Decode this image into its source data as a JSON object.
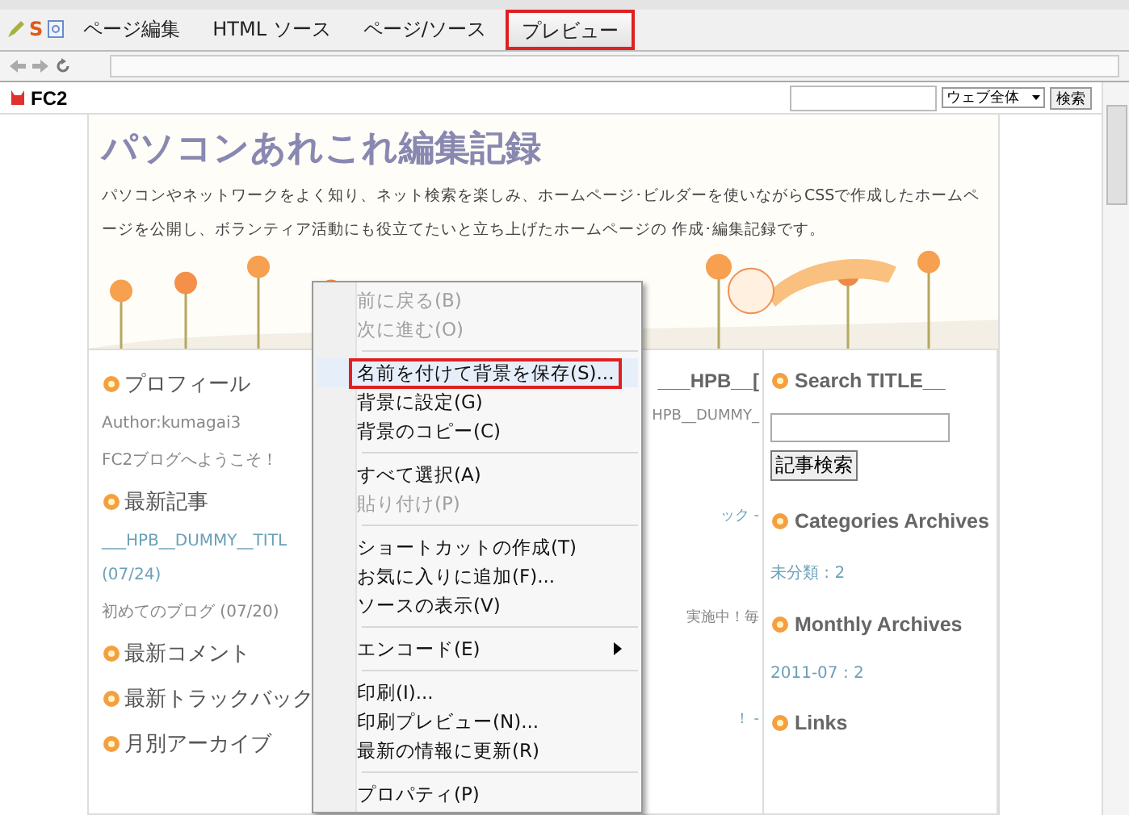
{
  "editor_tabs": [
    {
      "label": "ページ編集",
      "selected": false,
      "annotated": false
    },
    {
      "label": "HTML ソース",
      "selected": false,
      "annotated": false
    },
    {
      "label": "ページ/ソース",
      "selected": false,
      "annotated": false
    },
    {
      "label": "プレビュー",
      "selected": true,
      "annotated": true
    }
  ],
  "s_icon": "S",
  "fc2_bar": {
    "logo": "FC2",
    "scope": "ウェブ全体",
    "search_button": "検索"
  },
  "blog": {
    "title": "パソコンあれこれ編集記録",
    "description": "パソコンやネットワークをよく知り、ネット検索を楽しみ、ホームページ･ビルダーを使いながらCSSで作成したホームページを公開し、ボランティア活動にも役立てたいと立ち上げたホームページの 作成･編集記録です。",
    "left_column": [
      {
        "kind": "heading",
        "text": "プロフィール"
      },
      {
        "kind": "text",
        "text": "Author:kumagai3"
      },
      {
        "kind": "text",
        "text": "FC2ブログへようこそ！"
      },
      {
        "kind": "heading",
        "text": "最新記事"
      },
      {
        "kind": "link",
        "text": "___HPB__DUMMY__TITL"
      },
      {
        "kind": "link",
        "text": "(07/24)"
      },
      {
        "kind": "text",
        "text": "初めてのブログ (07/20)"
      },
      {
        "kind": "heading",
        "text": "最新コメント"
      },
      {
        "kind": "heading",
        "text": "最新トラックバック"
      },
      {
        "kind": "heading",
        "text": "月別アーカイブ"
      }
    ],
    "center_column": [
      {
        "kind": "heading",
        "text": "___HPB__["
      },
      {
        "kind": "text",
        "text": "HPB__DUMMY_"
      },
      {
        "kind": "link",
        "text": "ック -"
      },
      {
        "kind": "text",
        "text": "実施中！毎"
      },
      {
        "kind": "link",
        "text": "！ -"
      }
    ],
    "right_column": {
      "search_heading": "Search",
      "search_heading_overlap": "TITLE__",
      "search_button": "記事検索",
      "sections": [
        {
          "kind": "heading",
          "text": "Categories Archives"
        },
        {
          "kind": "link",
          "text": "未分類 : 2"
        },
        {
          "kind": "heading",
          "text": "Monthly Archives"
        },
        {
          "kind": "link",
          "text": "2011-07 : 2"
        },
        {
          "kind": "heading",
          "text": "Links"
        }
      ]
    }
  },
  "context_menu": {
    "groups": [
      {
        "items": [
          {
            "label": "前に戻る(B)",
            "disabled": true,
            "selected": false
          },
          {
            "label": "次に進む(O)",
            "disabled": true,
            "selected": false
          }
        ]
      },
      {
        "items": [
          {
            "label": "名前を付けて背景を保存(S)...",
            "disabled": false,
            "selected": true
          },
          {
            "label": "背景に設定(G)",
            "disabled": false,
            "selected": false
          },
          {
            "label": "背景のコピー(C)",
            "disabled": false,
            "selected": false
          }
        ]
      },
      {
        "items": [
          {
            "label": "すべて選択(A)",
            "disabled": false,
            "selected": false
          },
          {
            "label": "貼り付け(P)",
            "disabled": true,
            "selected": false
          }
        ]
      },
      {
        "items": [
          {
            "label": "ショートカットの作成(T)",
            "disabled": false,
            "selected": false
          },
          {
            "label": "お気に入りに追加(F)...",
            "disabled": false,
            "selected": false
          },
          {
            "label": "ソースの表示(V)",
            "disabled": false,
            "selected": false
          }
        ]
      },
      {
        "items": [
          {
            "label": "エンコード(E)",
            "disabled": false,
            "selected": false,
            "submenu": true
          }
        ]
      },
      {
        "items": [
          {
            "label": "印刷(I)...",
            "disabled": false,
            "selected": false
          },
          {
            "label": "印刷プレビュー(N)...",
            "disabled": false,
            "selected": false
          },
          {
            "label": "最新の情報に更新(R)",
            "disabled": false,
            "selected": false
          }
        ]
      },
      {
        "items": [
          {
            "label": "プロパティ(P)",
            "disabled": false,
            "selected": false
          }
        ]
      }
    ]
  }
}
